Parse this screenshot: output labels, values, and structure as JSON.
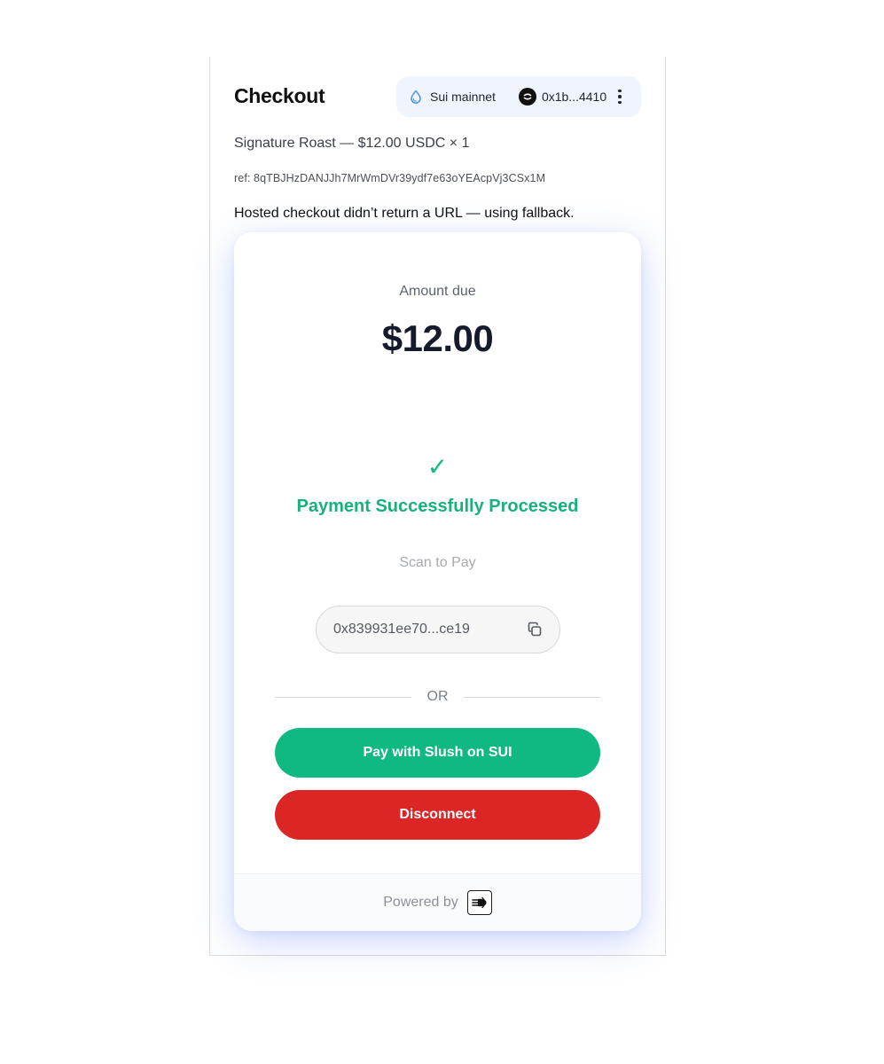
{
  "header": {
    "title": "Checkout",
    "network_label": "Sui mainnet",
    "network_icon": "droplet-icon",
    "wallet_address": "0x1b...4410",
    "menu_icon": "kebab-menu-icon"
  },
  "order": {
    "product_line": "Signature Roast — $12.00 USDC × 1",
    "reference": "ref: 8qTBJHzDANJJh7MrWmDVr39ydf7e63oYEAcpVj3CSx1M",
    "notice": "Hosted checkout didn’t return a URL — using fallback."
  },
  "payment": {
    "amount_label": "Amount due",
    "amount_value": "$12.00",
    "status_icon": "✓",
    "status_text": "Payment Successfully Processed",
    "scan_label": "Scan to Pay",
    "recipient_address": "0x839931ee70...ce19",
    "or_label": "OR",
    "pay_button_label": "Pay with Slush on SUI",
    "disconnect_button_label": "Disconnect",
    "powered_by_label": "Powered by"
  },
  "colors": {
    "success": "#10b981",
    "danger": "#dc2626",
    "title": "#151b2c",
    "wallet_pill_bg": "#f0f4fc"
  }
}
